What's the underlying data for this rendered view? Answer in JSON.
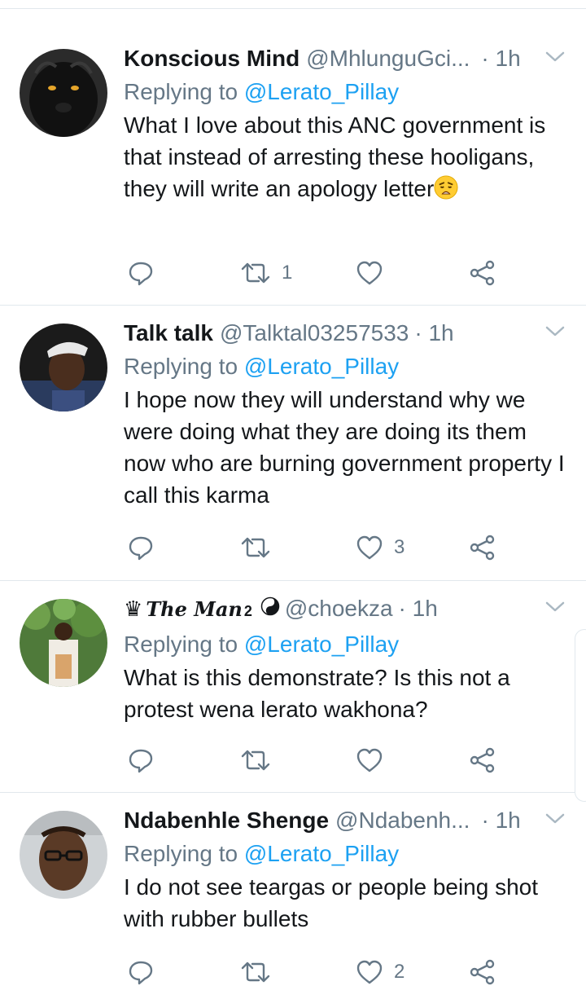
{
  "tweets": [
    {
      "display_name": "Konscious Mind",
      "handle": "@MhlunguGci...",
      "time": "· 1h",
      "replying_prefix": "Replying to",
      "replying_to": "@Lerato_Pillay",
      "text": "What I love about this ANC government is that instead of arresting these hooligans, they will write an apology letter",
      "emoji": "weary-face-emoji",
      "retweets": "1",
      "likes": "",
      "avatar": "black-panther-avatar"
    },
    {
      "display_name": "Talk talk",
      "handle": "@Talktal03257533",
      "time": "· 1h",
      "replying_prefix": "Replying to",
      "replying_to": "@Lerato_Pillay",
      "text": "I hope now they will understand why we were doing what they are doing its them now who are burning government property I call this karma",
      "retweets": "",
      "likes": "3",
      "avatar": "man-with-cap-avatar"
    },
    {
      "display_name_prefix": "♛",
      "display_name": "The Man",
      "display_name_sup": "2",
      "handle": "@choekza",
      "time": "· 1h",
      "replying_prefix": "Replying to",
      "replying_to": "@Lerato_Pillay",
      "text": "What is this demonstrate? Is this not a protest wena lerato wakhona?",
      "retweets": "",
      "likes": "",
      "avatar": "man-under-tree-avatar"
    },
    {
      "display_name": "Ndabenhle Shenge",
      "handle": "@Ndabenh...",
      "time": "· 1h",
      "replying_prefix": "Replying to",
      "replying_to": "@Lerato_Pillay",
      "text": "I do not see teargas or people being shot with rubber bullets",
      "retweets": "",
      "likes": "2",
      "avatar": "man-with-glasses-avatar"
    }
  ],
  "colors": {
    "link": "#1da1f2",
    "secondary_text": "#657786",
    "primary_text": "#14171a",
    "divider": "#e1e8ed"
  },
  "icons": [
    "reply-icon",
    "retweet-icon",
    "like-icon",
    "share-icon",
    "chevron-down-icon"
  ]
}
